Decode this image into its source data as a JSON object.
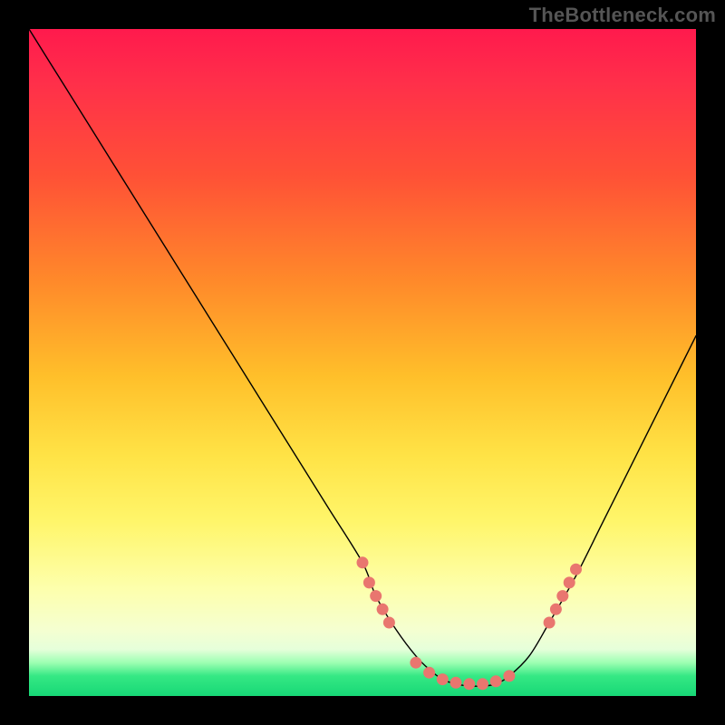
{
  "watermark": "TheBottleneck.com",
  "colors": {
    "background": "#000000",
    "gradient_top": "#ff1a4d",
    "gradient_mid": "#ffe346",
    "gradient_bottom": "#17d876",
    "curve": "#000000",
    "dot": "#e9766f"
  },
  "chart_data": {
    "type": "line",
    "title": "",
    "xlabel": "",
    "ylabel": "",
    "xlim": [
      0,
      100
    ],
    "ylim": [
      0,
      100
    ],
    "series": [
      {
        "name": "bottleneck-curve",
        "x": [
          0,
          5,
          10,
          15,
          20,
          25,
          30,
          35,
          40,
          45,
          50,
          52,
          55,
          58,
          60,
          62,
          64,
          66,
          68,
          70,
          72,
          75,
          78,
          82,
          86,
          90,
          94,
          98,
          100
        ],
        "y": [
          100,
          92,
          84,
          76,
          68,
          60,
          52,
          44,
          36,
          28,
          20,
          15,
          10,
          6,
          4,
          2.5,
          1.8,
          1.5,
          1.5,
          1.8,
          3,
          6,
          11,
          18,
          26,
          34,
          42,
          50,
          54
        ]
      }
    ],
    "markers": [
      {
        "name": "cluster-left",
        "x": 50,
        "y": 20
      },
      {
        "name": "cluster-left",
        "x": 51,
        "y": 17
      },
      {
        "name": "cluster-left",
        "x": 52,
        "y": 15
      },
      {
        "name": "cluster-left",
        "x": 53,
        "y": 13
      },
      {
        "name": "cluster-left",
        "x": 54,
        "y": 11
      },
      {
        "name": "valley",
        "x": 58,
        "y": 5
      },
      {
        "name": "valley",
        "x": 60,
        "y": 3.5
      },
      {
        "name": "valley",
        "x": 62,
        "y": 2.5
      },
      {
        "name": "valley",
        "x": 64,
        "y": 2
      },
      {
        "name": "valley",
        "x": 66,
        "y": 1.8
      },
      {
        "name": "valley",
        "x": 68,
        "y": 1.8
      },
      {
        "name": "valley",
        "x": 70,
        "y": 2.2
      },
      {
        "name": "valley",
        "x": 72,
        "y": 3
      },
      {
        "name": "cluster-right",
        "x": 78,
        "y": 11
      },
      {
        "name": "cluster-right",
        "x": 79,
        "y": 13
      },
      {
        "name": "cluster-right",
        "x": 80,
        "y": 15
      },
      {
        "name": "cluster-right",
        "x": 81,
        "y": 17
      },
      {
        "name": "cluster-right",
        "x": 82,
        "y": 19
      }
    ]
  }
}
